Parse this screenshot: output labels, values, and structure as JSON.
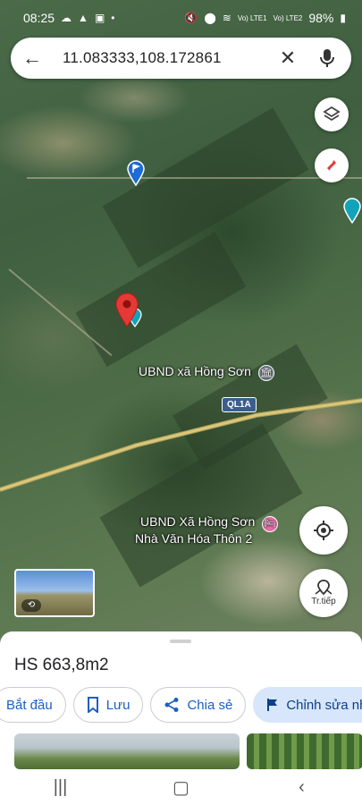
{
  "status_bar": {
    "time": "08:25",
    "battery": "98%",
    "volte1": "Vo) LTE1",
    "volte2": "Vo) LTE2"
  },
  "search": {
    "query": "11.083333,108.172861",
    "back_icon": "back-arrow-icon",
    "clear_icon": "close-icon",
    "mic_icon": "mic-icon"
  },
  "map": {
    "labels": {
      "ubnd_1": "UBND xã Hồng Sơn",
      "ubnd_2": "UBND Xã Hồng Sơn",
      "nha_van_hoa": "Nhà Văn Hóa Thôn 2",
      "route": "QL1A"
    },
    "controls": {
      "layers_icon": "layers-icon",
      "compass_icon": "compass-icon",
      "location_icon": "my-location-icon",
      "directions_label": "Tr.tiếp"
    }
  },
  "place": {
    "title": "HS 663,8m2"
  },
  "actions": [
    {
      "label": "Bắt đầu",
      "icon": ""
    },
    {
      "label": "Lưu",
      "icon": "bookmark-icon"
    },
    {
      "label": "Chia sẻ",
      "icon": "share-icon"
    },
    {
      "label": "Chỉnh sửa nh",
      "icon": "flag-icon"
    }
  ],
  "colors": {
    "accent_blue": "#1a73e8",
    "pin_red": "#e53935",
    "sheet_bg": "#ffffff"
  }
}
